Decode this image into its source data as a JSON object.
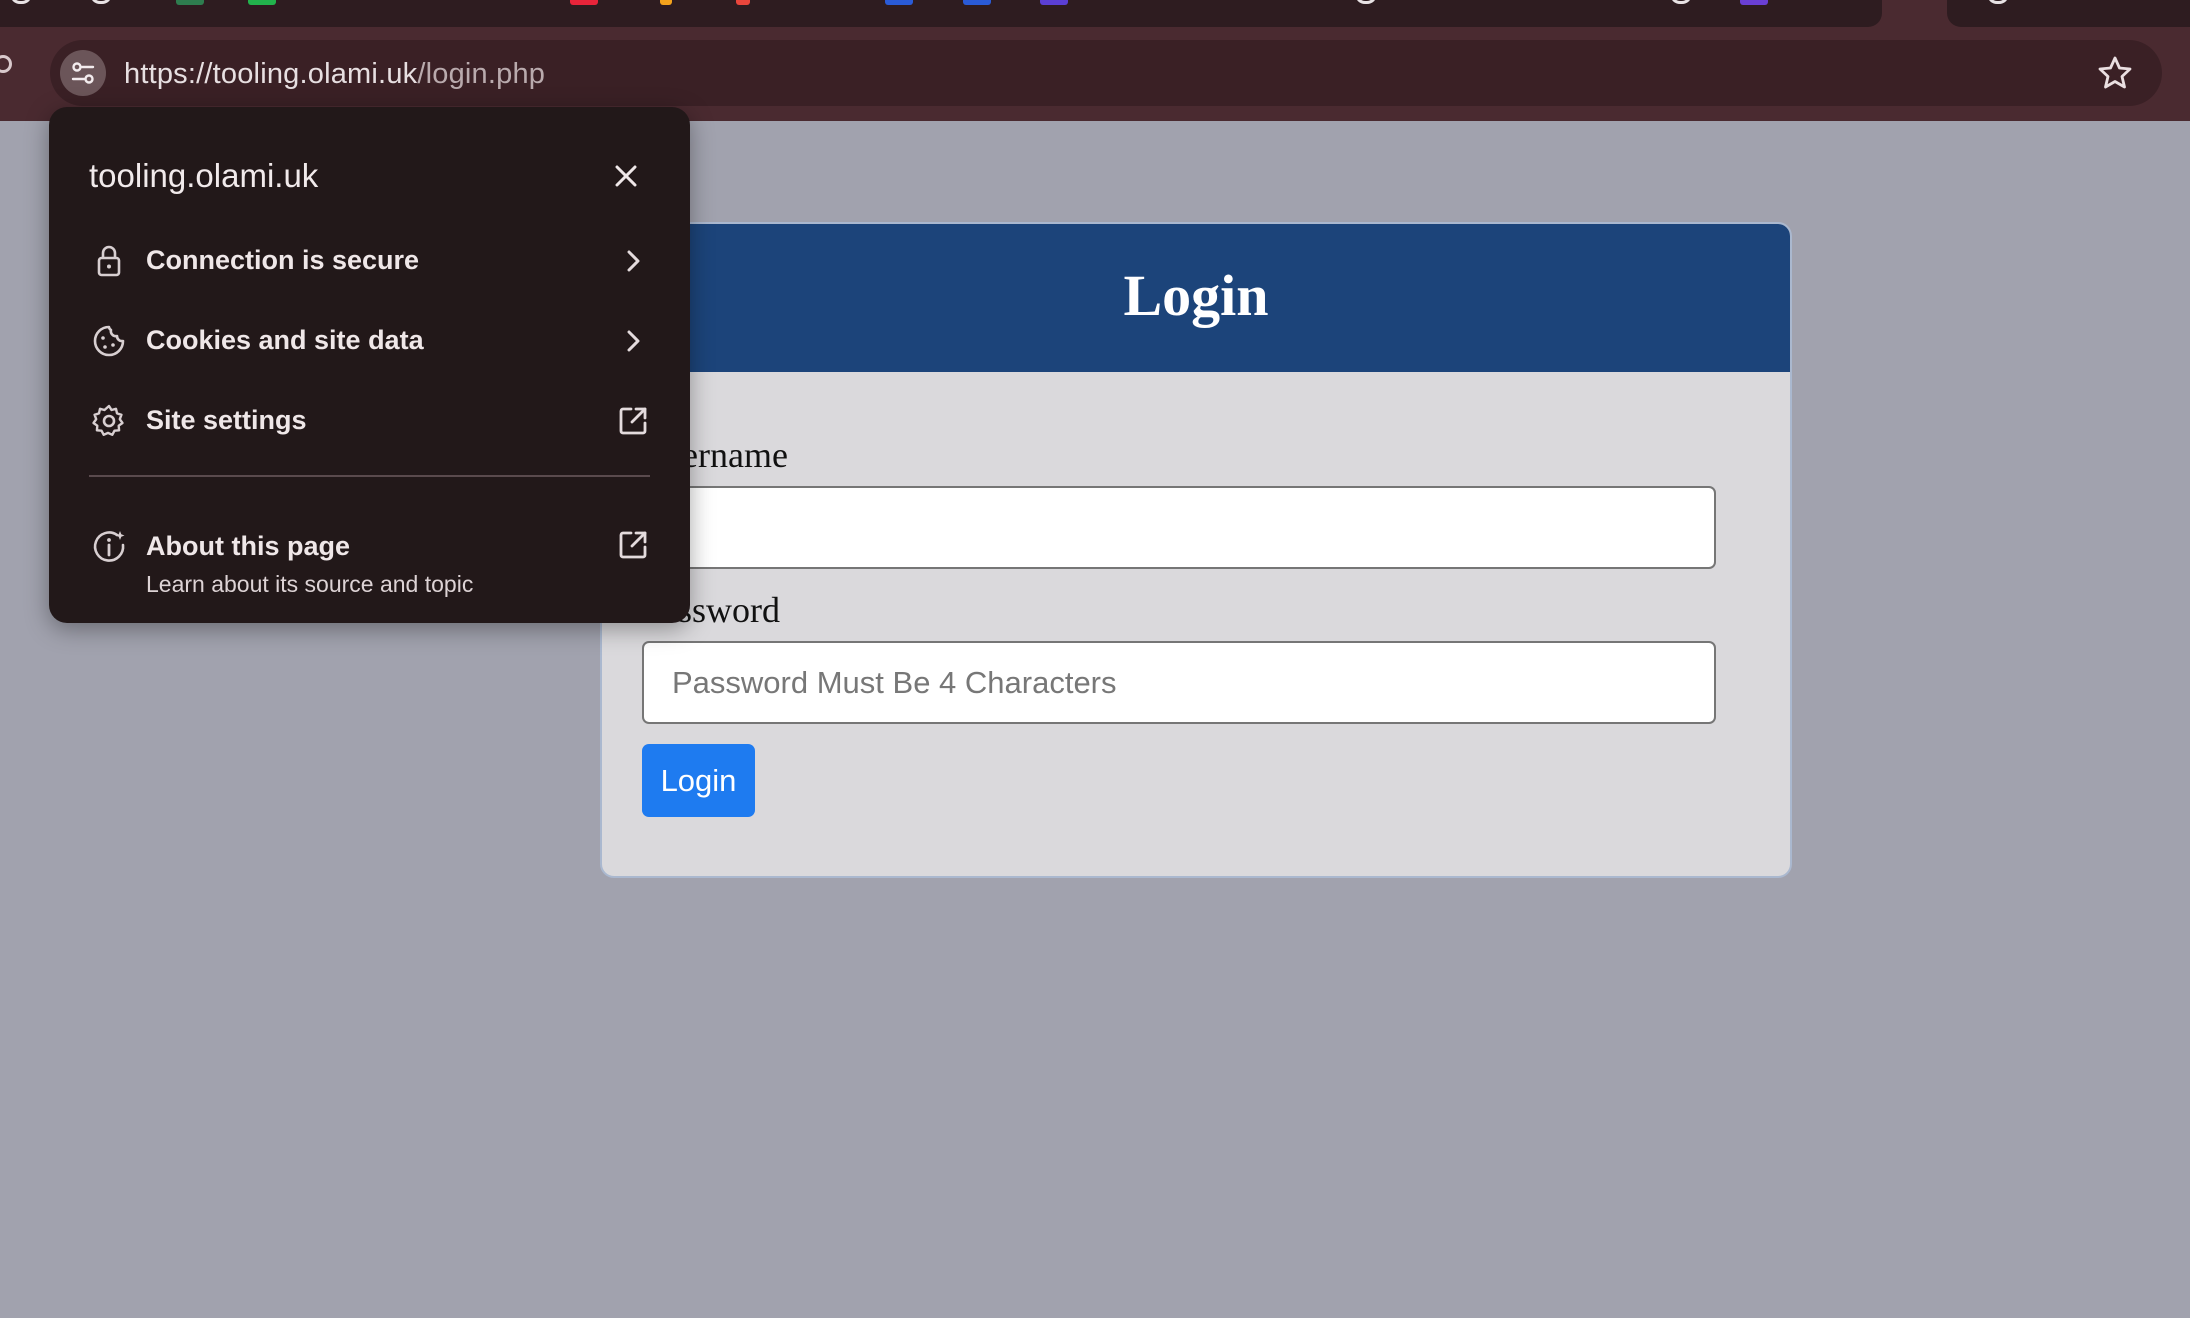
{
  "browser": {
    "url_host": "https://tooling.olami.uk",
    "url_path": "/login.php"
  },
  "site_info_popup": {
    "domain": "tooling.olami.uk",
    "items": [
      {
        "label": "Connection is secure",
        "icon": "lock-icon",
        "trail": "chevron-right-icon"
      },
      {
        "label": "Cookies and site data",
        "icon": "cookie-icon",
        "trail": "chevron-right-icon"
      },
      {
        "label": "Site settings",
        "icon": "gear-icon",
        "trail": "external-link-icon"
      }
    ],
    "about": {
      "label": "About this page",
      "sublabel": "Learn about its source and topic",
      "icon": "info-sparkle-icon",
      "trail": "external-link-icon"
    }
  },
  "login_form": {
    "title": "Login",
    "username_label": "Username",
    "username_value": "",
    "password_label": "Password",
    "password_placeholder": "Password Must Be 4 Characters",
    "submit_label": "Login"
  },
  "colors": {
    "page_background": "#a1a2ae",
    "header_blue": "#1c447a",
    "button_blue": "#1e7bf0",
    "popup_background": "#221819",
    "toolbar": "#4a2a30"
  }
}
